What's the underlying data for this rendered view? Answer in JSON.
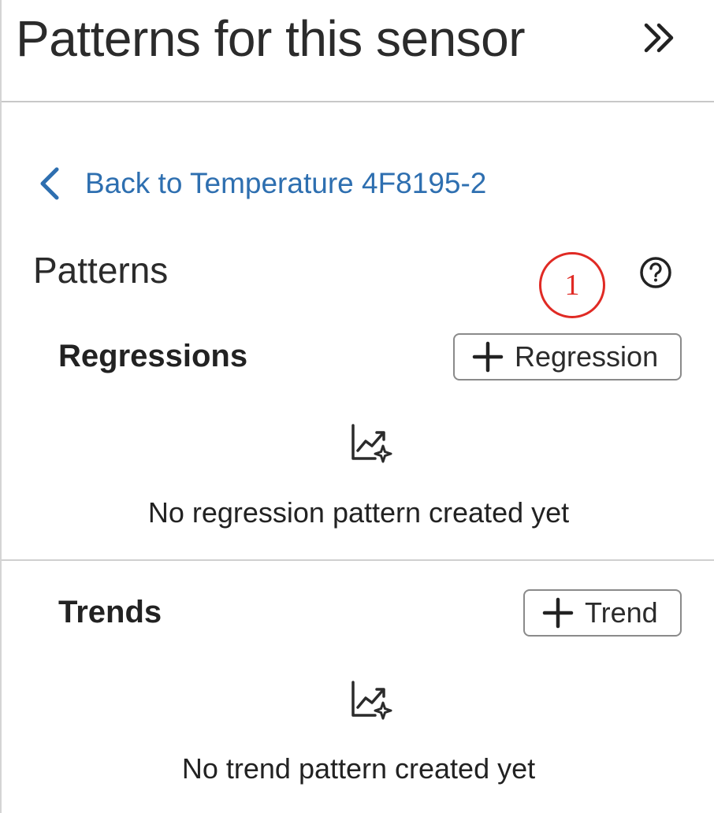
{
  "header": {
    "title": "Patterns for this sensor",
    "collapse_icon": "double-chevron-right-icon"
  },
  "back_link": {
    "label": "Back to Temperature 4F8195-2",
    "icon": "chevron-left-icon",
    "color": "#2e6fb0"
  },
  "patterns": {
    "title": "Patterns",
    "help_icon": "question-circle-icon"
  },
  "annotation": {
    "label": "1",
    "color": "#e02a24"
  },
  "regressions": {
    "title": "Regressions",
    "add_label": "Regression",
    "empty_icon": "chart-sparkle-icon",
    "empty_text": "No regression pattern created yet"
  },
  "trends": {
    "title": "Trends",
    "add_label": "Trend",
    "empty_icon": "chart-sparkle-icon",
    "empty_text": "No trend pattern created yet"
  }
}
